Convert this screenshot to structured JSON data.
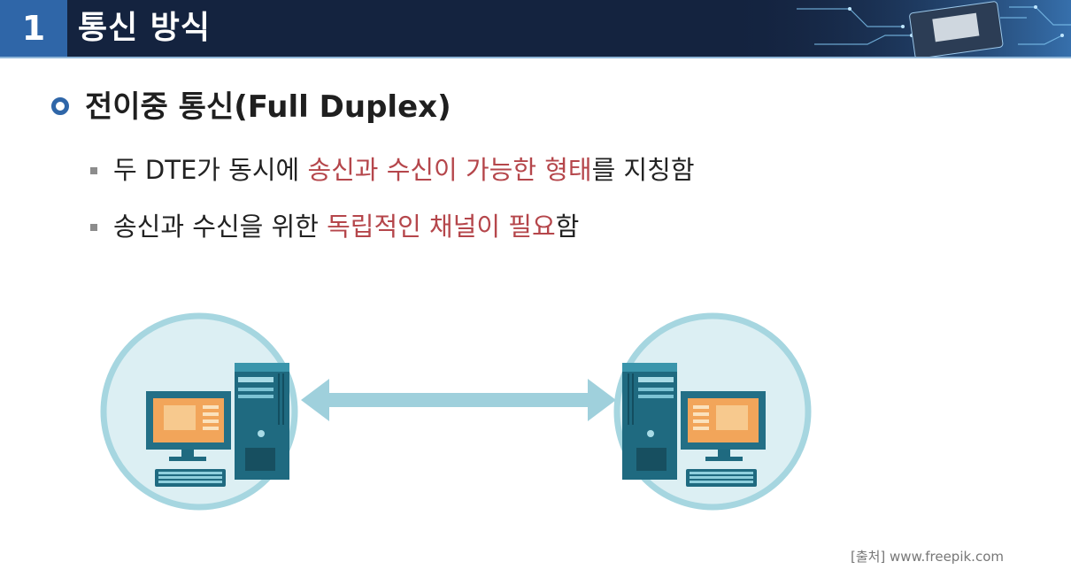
{
  "header": {
    "number": "1",
    "title": "통신 방식"
  },
  "heading": "전이중 통신(Full Duplex)",
  "bullets": [
    {
      "before": "두 DTE가 동시에 ",
      "highlight": "송신과 수신이 가능한 형태",
      "after": "를 지칭함"
    },
    {
      "before": "송신과 수신을 위한 ",
      "highlight": "독립적인 채널이 필요",
      "after": "함"
    }
  ],
  "credit": "[출처] www.freepik.com",
  "colors": {
    "header_bg": "#14233f",
    "number_bg": "#2f66a8",
    "highlight": "#b5464b",
    "circle": "#a6d6e0",
    "arrow": "#9fd0dc",
    "monitor_screen": "#f2a55a"
  },
  "icons": {
    "left_computer": "computer-icon",
    "right_computer": "computer-icon",
    "arrow": "double-arrow-icon"
  }
}
